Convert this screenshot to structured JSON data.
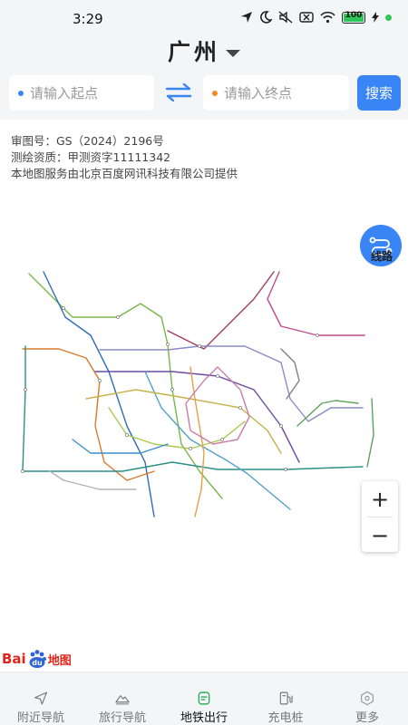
{
  "status": {
    "time": "3:29",
    "battery": "100"
  },
  "header": {
    "city": "广州"
  },
  "search": {
    "from_placeholder": "请输入起点",
    "to_placeholder": "请输入终点",
    "button": "搜索"
  },
  "info_lines": [
    "审图号：GS（2024）2196号",
    "测绘资质：甲测资字11111342",
    "本地图服务由北京百度网讯科技有限公司提供"
  ],
  "route_button": {
    "label": "线路"
  },
  "zoom": {
    "in": "+",
    "out": "−"
  },
  "logo": {
    "bai": "Bai",
    "du": "du",
    "ditu": "地图"
  },
  "tabs": [
    {
      "label": "附近导航",
      "icon": "navigation-arrow-icon"
    },
    {
      "label": "旅行导航",
      "icon": "mountain-icon"
    },
    {
      "label": "地铁出行",
      "icon": "subway-card-icon",
      "active": true
    },
    {
      "label": "充电桩",
      "icon": "charging-station-icon"
    },
    {
      "label": "更多",
      "icon": "hexagon-icon"
    }
  ],
  "colors": {
    "accent": "#3a85f5",
    "from_dot": "#3a85f5",
    "to_dot": "#f08a24",
    "active_tab": "#2eae5a"
  }
}
